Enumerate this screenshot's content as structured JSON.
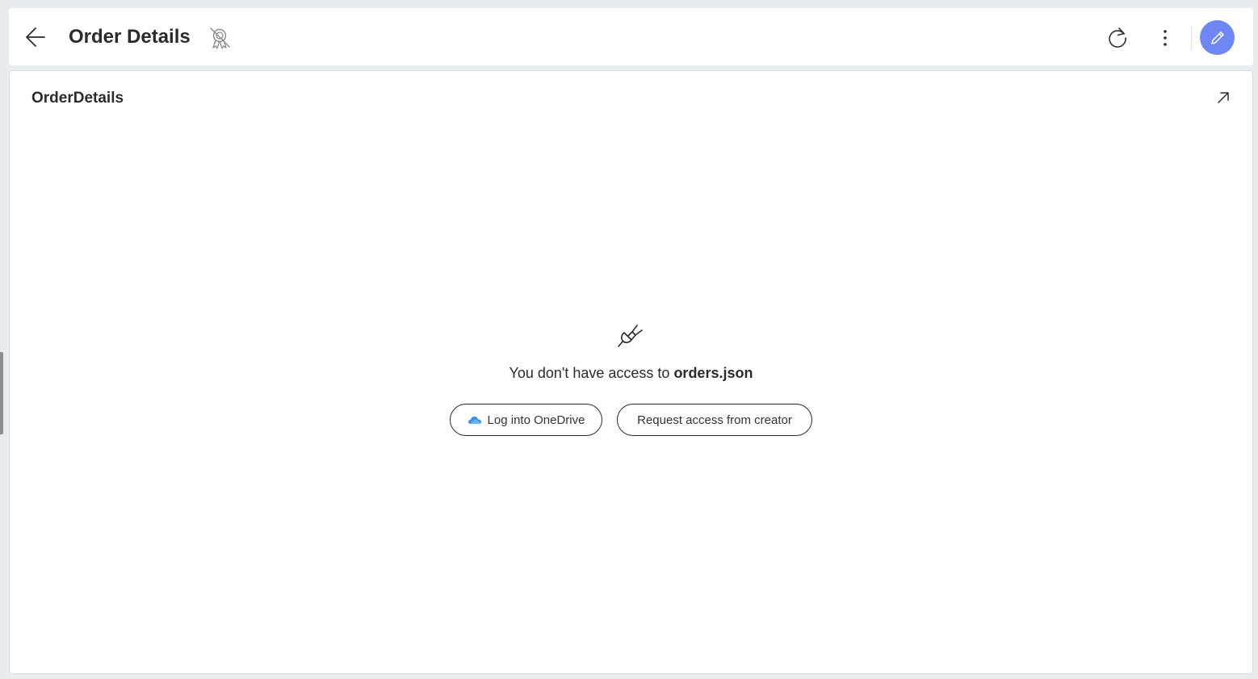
{
  "header": {
    "title": "Order Details"
  },
  "panel": {
    "title": "OrderDetails",
    "message_prefix": "You don't have access to ",
    "message_file": "orders.json",
    "login_button": "Log into OneDrive",
    "request_button": "Request access from creator"
  },
  "colors": {
    "accent": "#6f87f4",
    "background": "#e8ebf0",
    "onedrive": "#3a8ee6"
  },
  "icons": {
    "back": "arrow-left-icon",
    "certificate": "certificate-off-icon",
    "refresh": "refresh-icon",
    "more": "more-vertical-icon",
    "edit": "pencil-icon",
    "expand": "expand-arrow-icon",
    "plug": "plug-disconnected-icon",
    "cloud": "onedrive-cloud-icon"
  }
}
